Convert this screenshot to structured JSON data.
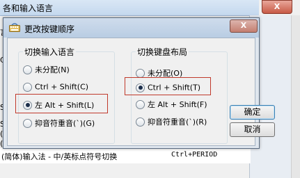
{
  "background": {
    "title_fragment": "各和输入语言",
    "close_label": "X",
    "fragments": [
      "言",
      "C",
      "S",
      "S",
      "(",
      "("
    ],
    "bottom_row": {
      "label": "(简体)输入法 - 中/英标点符号切换",
      "shortcut": "Ctrl+PERIOD"
    }
  },
  "dialog": {
    "title": "更改按键顺序",
    "close_label": "X",
    "input_language_group": {
      "title": "切换输入语言",
      "options": [
        {
          "label": "未分配(N)",
          "selected": false
        },
        {
          "label": "Ctrl + Shift(C)",
          "selected": false
        },
        {
          "label": "左 Alt + Shift(L)",
          "selected": true
        },
        {
          "label": "抑音符重音(`)(G)",
          "selected": false
        }
      ]
    },
    "keyboard_layout_group": {
      "title": "切换键盘布局",
      "options": [
        {
          "label": "未分配(O)",
          "selected": false
        },
        {
          "label": "Ctrl + Shift(T)",
          "selected": true
        },
        {
          "label": "左 Alt + Shift(F)",
          "selected": false
        },
        {
          "label": "抑音符重音(`)(R)",
          "selected": false
        }
      ]
    },
    "ok_button": "确定",
    "cancel_button": "取消"
  },
  "colors": {
    "highlight_box": "#c0392b",
    "title_bar": "#c4d8ee"
  }
}
